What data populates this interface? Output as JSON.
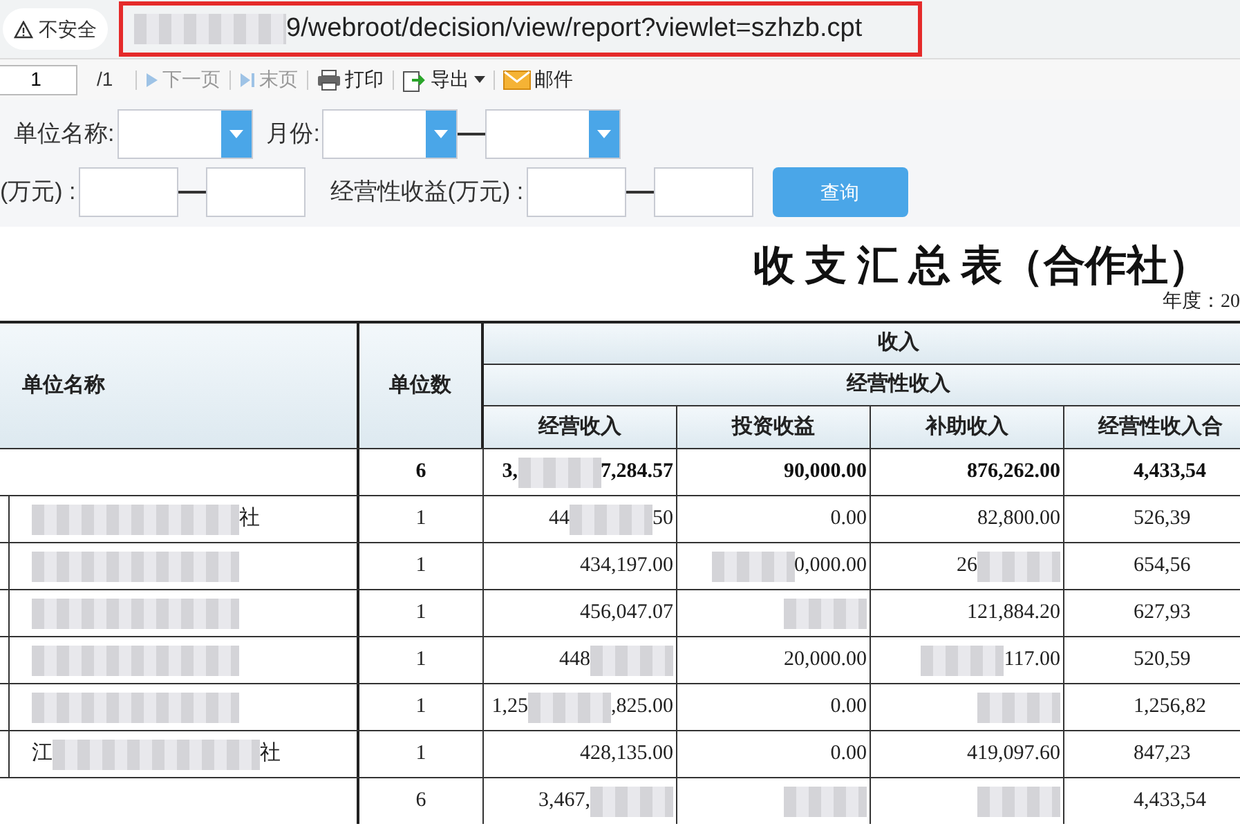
{
  "address_bar": {
    "security": "不安全",
    "url": {
      "text": "9/webroot/decision/view/report?viewlet=szhzb.cpt",
      "kind": "mask_before"
    },
    "highlighted": true
  },
  "toolbar": {
    "page_value": "1",
    "page_total": "/1",
    "buttons": [
      {
        "label": "下一页",
        "kind": "next",
        "disabled": true,
        "caret": false
      },
      {
        "label": "末页",
        "kind": "last",
        "disabled": true,
        "caret": false
      },
      {
        "label": "打印",
        "kind": "print",
        "disabled": false,
        "caret": false
      },
      {
        "label": "导出",
        "kind": "export",
        "disabled": false,
        "caret": true
      },
      {
        "label": "邮件",
        "kind": "mail",
        "disabled": false,
        "caret": false
      }
    ]
  },
  "filters": [
    [
      {
        "label": "单位名称:",
        "kind": "select"
      },
      {
        "label": "月份:",
        "kind": "select_range"
      }
    ],
    [
      {
        "label": "(万元) :",
        "kind": "range"
      },
      {
        "label": "经营性收益(万元) :",
        "kind": "range"
      }
    ]
  ],
  "query_button": "查询",
  "report": {
    "title": "收 支 汇 总 表（合作社）",
    "year_label": "年度：20",
    "header": {
      "name": "单位名称",
      "count": "单位数",
      "group": "收入",
      "subgroup": "经营性收入",
      "columns": [
        "经营收入",
        "投资收益",
        "补助收入",
        "经营性收入合"
      ]
    },
    "rows": [
      {
        "kind": "total",
        "count": "6",
        "values": [
          {
            "text": "3,",
            "kind": "mask_after",
            "tail": "7,284.57"
          },
          {
            "text": "90,000.00"
          },
          {
            "text": "876,262.00"
          },
          {
            "text": "4,433,54"
          }
        ]
      },
      {
        "kind": "entry",
        "name": {
          "text": "社",
          "kind": "mask_before"
        },
        "count": "1",
        "values": [
          {
            "text": "44",
            "kind": "mask_after",
            "tail": "50"
          },
          {
            "text": "0.00"
          },
          {
            "text": "82,800.00"
          },
          {
            "text": "526,39"
          }
        ]
      },
      {
        "kind": "entry",
        "name": {
          "kind": "mask_before"
        },
        "count": "1",
        "values": [
          {
            "text": "434,197.00"
          },
          {
            "text": "0,000.00",
            "kind": "mask_before"
          },
          {
            "text": "26",
            "kind": "mask_after"
          },
          {
            "text": "654,56"
          }
        ]
      },
      {
        "kind": "entry",
        "name": {
          "kind": "mask_before"
        },
        "count": "1",
        "values": [
          {
            "text": "456,047.07"
          },
          {
            "kind": "mask_before"
          },
          {
            "text": "121,884.20"
          },
          {
            "text": "627,93"
          }
        ]
      },
      {
        "kind": "entry",
        "name": {
          "kind": "mask_before"
        },
        "count": "1",
        "values": [
          {
            "text": "448",
            "kind": "mask_after"
          },
          {
            "text": "20,000.00"
          },
          {
            "text": "117.00",
            "kind": "mask_before"
          },
          {
            "text": "520,59"
          }
        ]
      },
      {
        "kind": "entry",
        "name": {
          "kind": "mask_before"
        },
        "count": "1",
        "values": [
          {
            "text": "1,25",
            "kind": "mask_after",
            "tail": ",825.00"
          },
          {
            "text": "0.00"
          },
          {
            "kind": "mask_before"
          },
          {
            "text": "1,256,82"
          }
        ]
      },
      {
        "kind": "entry",
        "name": {
          "text": "江",
          "kind": "mask_after",
          "tail": "社"
        },
        "count": "1",
        "values": [
          {
            "text": "428,135.00"
          },
          {
            "text": "0.00"
          },
          {
            "text": "419,097.60"
          },
          {
            "text": "847,23"
          }
        ]
      },
      {
        "kind": "summary",
        "count": "6",
        "values": [
          {
            "text": "3,467,",
            "kind": "mask_after"
          },
          {
            "kind": "mask_before"
          },
          {
            "kind": "mask_before"
          },
          {
            "text": "4,433,54"
          }
        ]
      }
    ]
  }
}
